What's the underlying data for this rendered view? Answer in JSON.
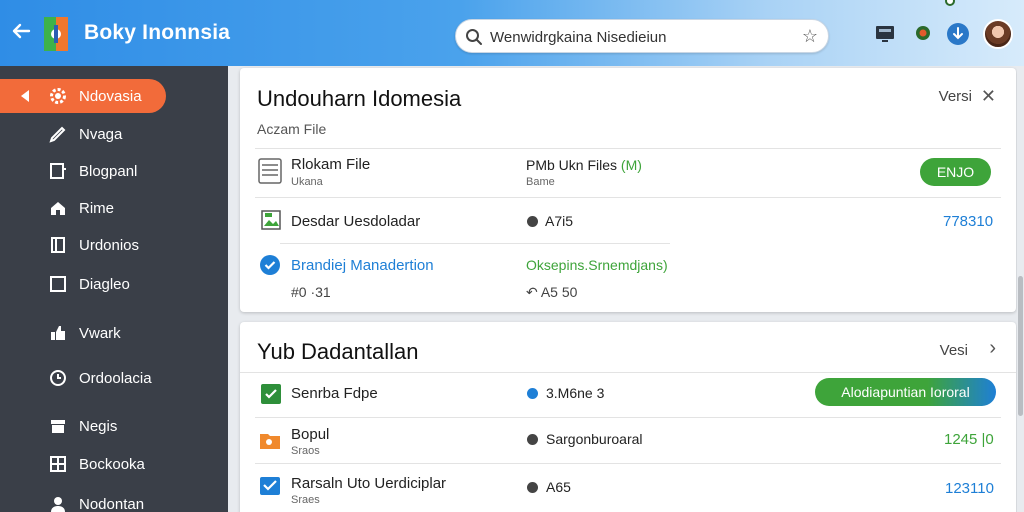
{
  "header": {
    "brand": "Boky Inonnsia",
    "search_value": "Wenwidrgkaina Nisedieiun",
    "icons": [
      "back-arrow-icon",
      "app-logo-icon",
      "search-icon",
      "star-icon",
      "monitor-icon",
      "location-icon",
      "download-icon"
    ]
  },
  "sidebar": {
    "active": "Ndovasia",
    "items": [
      {
        "label": "Nvaga",
        "icon": "pen-icon"
      },
      {
        "label": "Blogpanl",
        "icon": "page-icon"
      },
      {
        "label": "Rime",
        "icon": "home-icon"
      },
      {
        "label": "Urdonios",
        "icon": "book-icon"
      },
      {
        "label": "Diagleo",
        "icon": "square-icon"
      },
      {
        "label": "Vwark",
        "icon": "thumb-icon"
      },
      {
        "label": "Ordoolacia",
        "icon": "clock-icon"
      },
      {
        "label": "Negis",
        "icon": "tray-icon"
      },
      {
        "label": "Bockooka",
        "icon": "grid-book-icon"
      },
      {
        "label": "Nodontan",
        "icon": "user-icon"
      }
    ]
  },
  "panel1": {
    "title": "Undouharn Idomesia",
    "versi": "Versi",
    "subtitle": "Aczam File",
    "rows": [
      {
        "title": "Rlokam File",
        "sub": "Ukana",
        "mid": "PMb Ukn Files",
        "mid_accent": "(M)",
        "mid_sub": "Bame",
        "action": "ENJO"
      },
      {
        "title": "Desdar Uesdoladar",
        "mid": "A7i5",
        "value": "778310"
      },
      {
        "title": "Brandiej Manadertion",
        "sub": "#0 ·31",
        "mid": "Oksepins.Srnemdjans)",
        "mid_sub": "↶ A5 50"
      }
    ]
  },
  "panel2": {
    "title": "Yub Dadantallan",
    "versi": "Vesi",
    "rows": [
      {
        "title": "Senrba Fdpe",
        "mid": "3.M6ne 3",
        "action": "Alodiapuntian Iororal"
      },
      {
        "title": "Bopul",
        "sub": "Sraos",
        "mid": "Sargonburoaral",
        "value": "1245 |0"
      },
      {
        "title": "Rarsaln Uto Uerdiciplar",
        "sub": "Sraes",
        "mid": "A65",
        "value": "123110"
      }
    ]
  },
  "colors": {
    "accent": "#f26b3a",
    "green": "#3ea43a",
    "blue": "#1e7fd6",
    "sidebar": "#3a3f48"
  }
}
